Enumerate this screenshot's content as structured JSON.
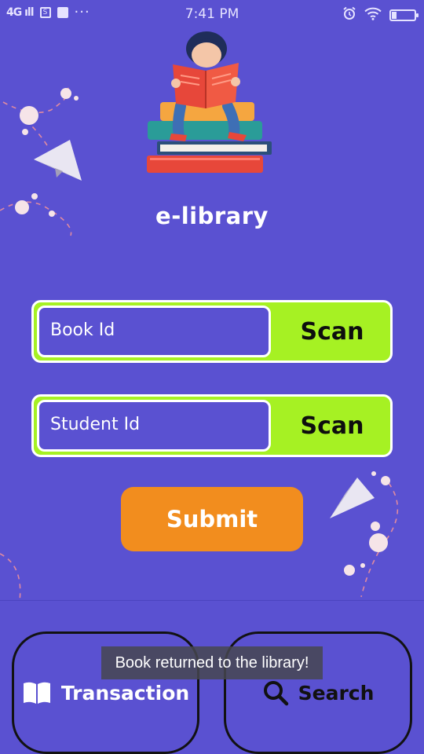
{
  "status_bar": {
    "signal": "4G",
    "time": "7:41 PM",
    "more": "···",
    "sim_badge": "S",
    "battery_level": 0.2
  },
  "app": {
    "title": "e-library",
    "accent_color": "#a6f123",
    "background_color": "#5a51d1",
    "submit_color": "#f28d1e"
  },
  "form": {
    "book_id": {
      "placeholder": "Book Id",
      "scan_label": "Scan"
    },
    "student_id": {
      "placeholder": "Student Id",
      "scan_label": "Scan"
    },
    "submit_label": "Submit"
  },
  "tabs": {
    "transaction": {
      "label": "Transaction",
      "icon": "book-icon"
    },
    "search": {
      "label": "Search",
      "icon": "search-icon"
    }
  },
  "toast": {
    "message": "Book returned to the library!"
  }
}
